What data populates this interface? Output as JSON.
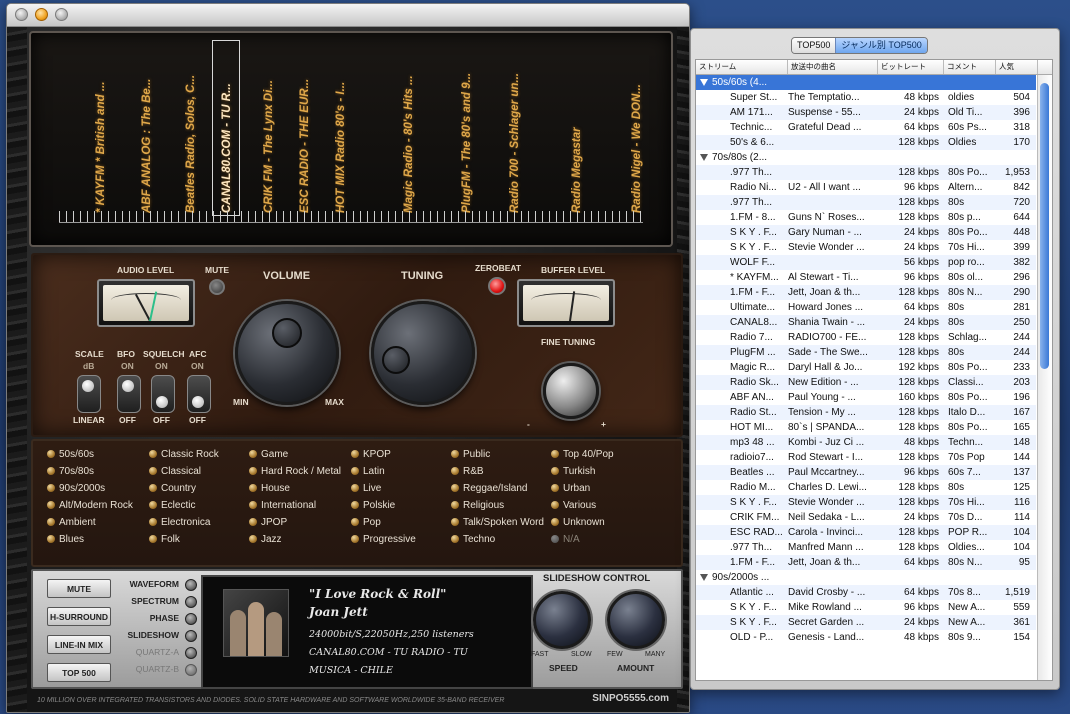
{
  "radio": {
    "stations": [
      "* KAYFM * British and ...",
      "ABF ANALOG : The Be...",
      "Beatles Radio, Solos, C...",
      "CANAL80.COM - TU R...",
      "CRIK FM - The Lynx Di...",
      "ESC RADIO - THE EUR...",
      "HOT MIX Radio 80's - I...",
      "Magic Radio - 80's Hits ...",
      "PlugFM - The 80's and 9...",
      "Radio 700 - Schlager un...",
      "Radio Megastar",
      "Radio Nigel - We DON..."
    ],
    "selected_station_index": 3,
    "labels": {
      "audio_level": "AUDIO LEVEL",
      "mute": "MUTE",
      "volume": "VOLUME",
      "tuning": "TUNING",
      "zerobeat": "ZEROBEAT",
      "buffer_level": "BUFFER LEVEL",
      "fine_tuning": "FINE TUNING",
      "min": "MIN",
      "max": "MAX",
      "minus": "-",
      "plus": "+"
    },
    "switches": [
      {
        "name": "SCALE",
        "top": "dB",
        "bottom": "LINEAR"
      },
      {
        "name": "BFO",
        "top": "ON",
        "bottom": "OFF"
      },
      {
        "name": "SQUELCH",
        "top": "ON",
        "bottom": "OFF"
      },
      {
        "name": "AFC",
        "top": "ON",
        "bottom": "OFF"
      }
    ],
    "genres": [
      [
        "50s/60s",
        "70s/80s",
        "90s/2000s",
        "Alt/Modern Rock",
        "Ambient",
        "Blues"
      ],
      [
        "Classic Rock",
        "Classical",
        "Country",
        "Eclectic",
        "Electronica",
        "Folk"
      ],
      [
        "Game",
        "Hard Rock / Metal",
        "House",
        "International",
        "JPOP",
        "Jazz"
      ],
      [
        "KPOP",
        "Latin",
        "Live",
        "Polskie",
        "Pop",
        "Progressive"
      ],
      [
        "Public",
        "R&B",
        "Reggae/Island",
        "Religious",
        "Talk/Spoken Word",
        "Techno"
      ],
      [
        "Top 40/Pop",
        "Turkish",
        "Urban",
        "Various",
        "Unknown",
        "N/A"
      ]
    ],
    "buttons": [
      "MUTE",
      "H-SURROUND",
      "LINE-IN MIX",
      "TOP 500"
    ],
    "modes": [
      "WAVEFORM",
      "SPECTRUM",
      "PHASE",
      "SLIDESHOW",
      "QUARTZ-A",
      "QUARTZ-B"
    ],
    "now_playing": {
      "title": "\"I Love Rock & Roll\"",
      "artist": "Joan Jett",
      "info": "24000bit/S,22050Hz,250 listeners",
      "station": "CANAL80.COM - TU RADIO - TU",
      "station2": "MUSICA - CHILE"
    },
    "slideshow": {
      "title": "SLIDESHOW CONTROL",
      "speed": "SPEED",
      "amount": "AMOUNT",
      "fast": "FAST",
      "slow": "SLOW",
      "few": "FEW",
      "many": "MANY"
    },
    "tagline": "10 MILLION OVER INTEGRATED TRANSISTORS AND DIODES.  SOLID STATE HARDWARE AND SOFTWARE WORLDWIDE 35-BAND RECEIVER",
    "brand": "SINPO5555.com"
  },
  "list": {
    "tabs": [
      "TOP500",
      "ジャンル別 TOP500"
    ],
    "active_tab": 1,
    "columns": [
      "ストリーム",
      "放送中の曲名",
      "ビットレート",
      "コメント",
      "人気"
    ],
    "rows": [
      {
        "group": "50s/60s (4...",
        "selected": true
      },
      {
        "c": [
          "Super St...",
          "The Temptatio...",
          "48 kbps",
          "oldies",
          "504"
        ]
      },
      {
        "c": [
          "AM 171...",
          "Suspense - 55...",
          "24 kbps",
          "Old Ti...",
          "396"
        ]
      },
      {
        "c": [
          "Technic...",
          "Grateful Dead ...",
          "64 kbps",
          "60s Ps...",
          "318"
        ]
      },
      {
        "c": [
          "50's & 6...",
          "",
          "128 kbps",
          "Oldies",
          "170"
        ]
      },
      {
        "group": "70s/80s (2...",
        "selected": false
      },
      {
        "c": [
          ".977 Th...",
          "",
          "128 kbps",
          "80s Po...",
          "1,953"
        ]
      },
      {
        "c": [
          "Radio Ni...",
          "U2 - All I want ...",
          "96 kbps",
          "Altern...",
          "842"
        ]
      },
      {
        "c": [
          ".977 Th...",
          "",
          "128 kbps",
          "80s",
          "720"
        ]
      },
      {
        "c": [
          "1.FM - 8...",
          "Guns N` Roses...",
          "128 kbps",
          "80s p...",
          "644"
        ]
      },
      {
        "c": [
          "S K Y . F...",
          "Gary Numan - ...",
          "24 kbps",
          "80s Po...",
          "448"
        ]
      },
      {
        "c": [
          "S K Y . F...",
          "Stevie Wonder ...",
          "24 kbps",
          "70s Hi...",
          "399"
        ]
      },
      {
        "c": [
          "WOLF F...",
          "",
          "56 kbps",
          "pop ro...",
          "382"
        ]
      },
      {
        "c": [
          "* KAYFM...",
          "Al Stewart - Ti...",
          "96 kbps",
          "80s ol...",
          "296"
        ]
      },
      {
        "c": [
          "1.FM - F...",
          "Jett, Joan & th...",
          "128 kbps",
          "80s N...",
          "290"
        ]
      },
      {
        "c": [
          "Ultimate...",
          "Howard Jones ...",
          "64 kbps",
          "80s",
          "281"
        ]
      },
      {
        "c": [
          "CANAL8...",
          "Shania Twain - ...",
          "24 kbps",
          "80s",
          "250"
        ]
      },
      {
        "c": [
          "Radio 7...",
          "RADIO700 - FE...",
          "128 kbps",
          "Schlag...",
          "244"
        ]
      },
      {
        "c": [
          "PlugFM ...",
          "Sade - The Swe...",
          "128 kbps",
          "80s",
          "244"
        ]
      },
      {
        "c": [
          "Magic R...",
          "Daryl Hall & Jo...",
          "192 kbps",
          "80s Po...",
          "233"
        ]
      },
      {
        "c": [
          "Radio Sk...",
          "New Edition - ...",
          "128 kbps",
          "Classi...",
          "203"
        ]
      },
      {
        "c": [
          "ABF AN...",
          " Paul Young - ...",
          "160 kbps",
          "80s Po...",
          "196"
        ]
      },
      {
        "c": [
          "Radio St...",
          "Tension - My ...",
          "128 kbps",
          "Italo D...",
          "167"
        ]
      },
      {
        "c": [
          "HOT MI...",
          "80`s | SPANDA...",
          "128 kbps",
          "80s Po...",
          "165"
        ]
      },
      {
        "c": [
          "mp3 48 ...",
          "Kombi - Juz Ci ...",
          "48 kbps",
          "Techn...",
          "148"
        ]
      },
      {
        "c": [
          "radioio7...",
          "Rod Stewart - I...",
          "128 kbps",
          "70s Pop",
          "144"
        ]
      },
      {
        "c": [
          "Beatles ...",
          "Paul Mccartney...",
          "96 kbps",
          "60s 7...",
          "137"
        ]
      },
      {
        "c": [
          "Radio M...",
          "Charles D. Lewi...",
          "128 kbps",
          "80s",
          "125"
        ]
      },
      {
        "c": [
          "S K Y . F...",
          "Stevie Wonder ...",
          "128 kbps",
          "70s Hi...",
          "116"
        ]
      },
      {
        "c": [
          "CRIK FM...",
          "Neil Sedaka - L...",
          "24 kbps",
          "70s D...",
          "114"
        ]
      },
      {
        "c": [
          "ESC RAD...",
          "Carola - Invinci...",
          "128 kbps",
          "POP R...",
          "104"
        ]
      },
      {
        "c": [
          ".977 Th...",
          "Manfred Mann ...",
          "128 kbps",
          "Oldies...",
          "104"
        ]
      },
      {
        "c": [
          "1.FM - F...",
          "Jett, Joan & th...",
          "64 kbps",
          "80s N...",
          "95"
        ]
      },
      {
        "group": "90s/2000s ...",
        "selected": false
      },
      {
        "c": [
          "Atlantic ...",
          "David Crosby - ...",
          "64 kbps",
          "70s 8...",
          "1,519"
        ]
      },
      {
        "c": [
          "S K Y . F...",
          "Mike Rowland ...",
          "96 kbps",
          "New A...",
          "559"
        ]
      },
      {
        "c": [
          "S K Y . F...",
          "Secret Garden ...",
          "24 kbps",
          "New A...",
          "361"
        ]
      },
      {
        "c": [
          "OLD - P...",
          "Genesis - Land...",
          "48 kbps",
          "80s 9...",
          "154"
        ]
      }
    ]
  }
}
